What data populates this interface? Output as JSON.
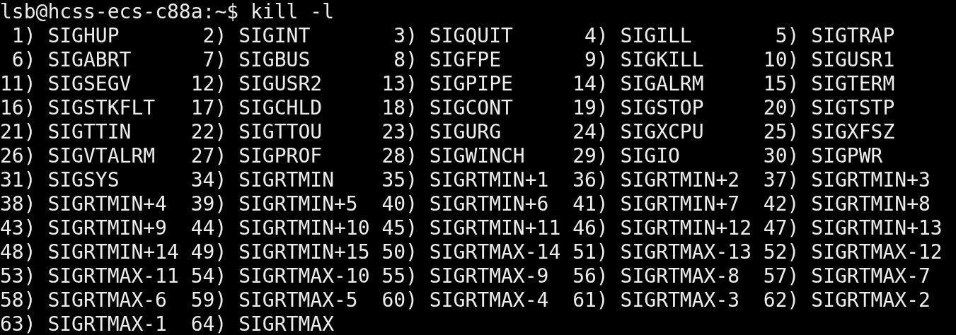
{
  "prompt": "lsb@hcss-ecs-c88a:~$",
  "command": "kill -l",
  "signals": [
    {
      "number": "1)",
      "name": "SIGHUP"
    },
    {
      "number": "2)",
      "name": "SIGINT"
    },
    {
      "number": "3)",
      "name": "SIGQUIT"
    },
    {
      "number": "4)",
      "name": "SIGILL"
    },
    {
      "number": "5)",
      "name": "SIGTRAP"
    },
    {
      "number": "6)",
      "name": "SIGABRT"
    },
    {
      "number": "7)",
      "name": "SIGBUS"
    },
    {
      "number": "8)",
      "name": "SIGFPE"
    },
    {
      "number": "9)",
      "name": "SIGKILL"
    },
    {
      "number": "10)",
      "name": "SIGUSR1"
    },
    {
      "number": "11)",
      "name": "SIGSEGV"
    },
    {
      "number": "12)",
      "name": "SIGUSR2"
    },
    {
      "number": "13)",
      "name": "SIGPIPE"
    },
    {
      "number": "14)",
      "name": "SIGALRM"
    },
    {
      "number": "15)",
      "name": "SIGTERM"
    },
    {
      "number": "16)",
      "name": "SIGSTKFLT"
    },
    {
      "number": "17)",
      "name": "SIGCHLD"
    },
    {
      "number": "18)",
      "name": "SIGCONT"
    },
    {
      "number": "19)",
      "name": "SIGSTOP"
    },
    {
      "number": "20)",
      "name": "SIGTSTP"
    },
    {
      "number": "21)",
      "name": "SIGTTIN"
    },
    {
      "number": "22)",
      "name": "SIGTTOU"
    },
    {
      "number": "23)",
      "name": "SIGURG"
    },
    {
      "number": "24)",
      "name": "SIGXCPU"
    },
    {
      "number": "25)",
      "name": "SIGXFSZ"
    },
    {
      "number": "26)",
      "name": "SIGVTALRM"
    },
    {
      "number": "27)",
      "name": "SIGPROF"
    },
    {
      "number": "28)",
      "name": "SIGWINCH"
    },
    {
      "number": "29)",
      "name": "SIGIO"
    },
    {
      "number": "30)",
      "name": "SIGPWR"
    },
    {
      "number": "31)",
      "name": "SIGSYS"
    },
    {
      "number": "34)",
      "name": "SIGRTMIN"
    },
    {
      "number": "35)",
      "name": "SIGRTMIN+1"
    },
    {
      "number": "36)",
      "name": "SIGRTMIN+2"
    },
    {
      "number": "37)",
      "name": "SIGRTMIN+3"
    },
    {
      "number": "38)",
      "name": "SIGRTMIN+4"
    },
    {
      "number": "39)",
      "name": "SIGRTMIN+5"
    },
    {
      "number": "40)",
      "name": "SIGRTMIN+6"
    },
    {
      "number": "41)",
      "name": "SIGRTMIN+7"
    },
    {
      "number": "42)",
      "name": "SIGRTMIN+8"
    },
    {
      "number": "43)",
      "name": "SIGRTMIN+9"
    },
    {
      "number": "44)",
      "name": "SIGRTMIN+10"
    },
    {
      "number": "45)",
      "name": "SIGRTMIN+11"
    },
    {
      "number": "46)",
      "name": "SIGRTMIN+12"
    },
    {
      "number": "47)",
      "name": "SIGRTMIN+13"
    },
    {
      "number": "48)",
      "name": "SIGRTMIN+14"
    },
    {
      "number": "49)",
      "name": "SIGRTMIN+15"
    },
    {
      "number": "50)",
      "name": "SIGRTMAX-14"
    },
    {
      "number": "51)",
      "name": "SIGRTMAX-13"
    },
    {
      "number": "52)",
      "name": "SIGRTMAX-12"
    },
    {
      "number": "53)",
      "name": "SIGRTMAX-11"
    },
    {
      "number": "54)",
      "name": "SIGRTMAX-10"
    },
    {
      "number": "55)",
      "name": "SIGRTMAX-9"
    },
    {
      "number": "56)",
      "name": "SIGRTMAX-8"
    },
    {
      "number": "57)",
      "name": "SIGRTMAX-7"
    },
    {
      "number": "58)",
      "name": "SIGRTMAX-6"
    },
    {
      "number": "59)",
      "name": "SIGRTMAX-5"
    },
    {
      "number": "60)",
      "name": "SIGRTMAX-4"
    },
    {
      "number": "61)",
      "name": "SIGRTMAX-3"
    },
    {
      "number": "62)",
      "name": "SIGRTMAX-2"
    },
    {
      "number": "63)",
      "name": "SIGRTMAX-1"
    },
    {
      "number": "64)",
      "name": "SIGRTMAX"
    }
  ]
}
